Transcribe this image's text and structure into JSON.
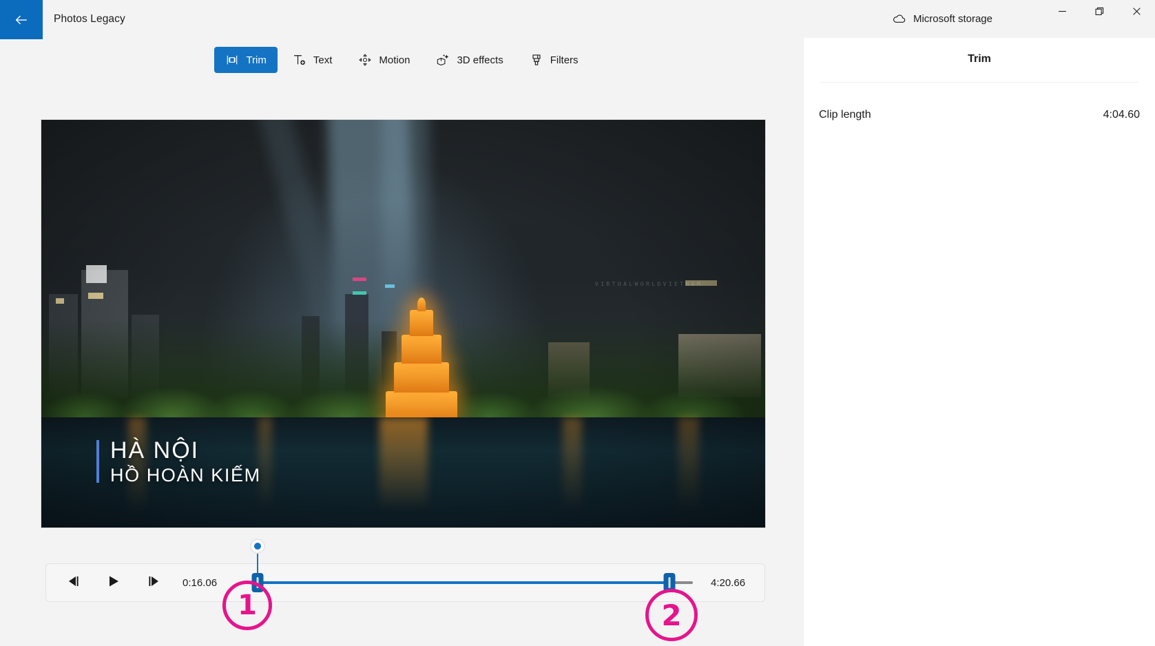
{
  "window": {
    "app_title": "Photos Legacy",
    "back_icon": "back-arrow-icon",
    "storage_label": "Microsoft storage",
    "storage_icon": "cloud-icon",
    "minimize_label": "Minimize",
    "restore_label": "Restore",
    "close_label": "Close"
  },
  "toolbar": {
    "tabs": [
      {
        "label": "Trim",
        "icon": "trim-icon",
        "active": true
      },
      {
        "label": "Text",
        "icon": "text-icon",
        "active": false
      },
      {
        "label": "Motion",
        "icon": "motion-icon",
        "active": false
      },
      {
        "label": "3D effects",
        "icon": "3d-effects-icon",
        "active": false
      },
      {
        "label": "Filters",
        "icon": "filters-icon",
        "active": false
      }
    ]
  },
  "video": {
    "caption_main": "HÀ NỘI",
    "caption_sub": "HỒ HOÀN KIẾM",
    "watermark": "VIRTUALWORLDVIETNAM"
  },
  "transport": {
    "prev_frame_icon": "previous-frame-icon",
    "play_icon": "play-icon",
    "next_frame_icon": "next-frame-icon",
    "start_time": "0:16.06",
    "end_time": "4:20.66",
    "trim_start_percent": 3.8,
    "trim_end_percent": 94.9,
    "playhead_percent": 3.8
  },
  "panel": {
    "title": "Trim",
    "clip_length_label": "Clip length",
    "clip_length_value": "4:04.60"
  },
  "annotations": [
    {
      "number": "1",
      "target": "trim-start-playhead"
    },
    {
      "number": "2",
      "target": "trim-end-handle"
    }
  ],
  "colors": {
    "accent_blue": "#1573c4",
    "back_button_blue": "#0b6bbd",
    "annotation_pink": "#e6148c",
    "panel_background": "#ffffff",
    "app_background": "#f3f3f3"
  }
}
